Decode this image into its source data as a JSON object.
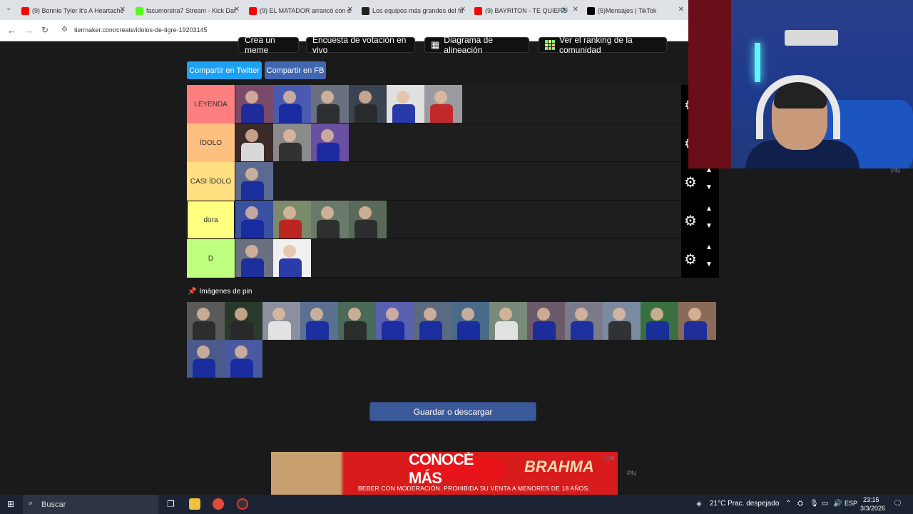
{
  "browser": {
    "tabs": [
      {
        "label": "(9) Bonnie Tyler It's A Heartache",
        "color": "#ff0000"
      },
      {
        "label": "facumoreira7 Stream - Kick Dat",
        "color": "#53fc18"
      },
      {
        "label": "(9) EL MATADOR arrancó con d",
        "color": "#ff0000"
      },
      {
        "label": "Los equipos más grandes del fú",
        "color": "#222222"
      },
      {
        "label": "(9) BAYRITON - TE QUIERO",
        "color": "#ff0000"
      },
      {
        "label": "(5)Mensajes | TikTok",
        "color": "#000000"
      }
    ],
    "url": "tiermaker.com/create/idolos-de-tigre-19203145"
  },
  "toolbar": {
    "meme": "Crea un meme",
    "poll": "Encuesta de votación en vivo",
    "alignment": "Diagrama de alineación",
    "ranking": "Ver el ranking de la comunidad"
  },
  "share": {
    "twitter": "Compartir en Twitter",
    "facebook": "Compartir en FB"
  },
  "tiers": [
    {
      "label": "LEYENDA",
      "color": "#ff7f7f"
    },
    {
      "label": "ÍDOLO",
      "color": "#ffbf7f"
    },
    {
      "label": "CASI ÍDOLO",
      "color": "#ffdf7f"
    },
    {
      "label": "dora",
      "color": "#ffff7f"
    },
    {
      "label": "D",
      "color": "#bfff7f"
    }
  ],
  "pin_title": "Imágenes de pin",
  "save_button": "Guardar o descargar",
  "ad": {
    "headline": "CONOCÉ MÁS",
    "brand": "BRAHMA",
    "fine_print": "BEBER CON MODERACIÓN. PROHIBIDA SU VENTA A MENORES DE 18 AÑOS."
  },
  "taskbar": {
    "search_label": "Buscar",
    "weather": "21°C  Prac. despejado",
    "lang": "ESP",
    "time": "23:15",
    "date": "3/3/2026"
  },
  "pn_label": "PN"
}
